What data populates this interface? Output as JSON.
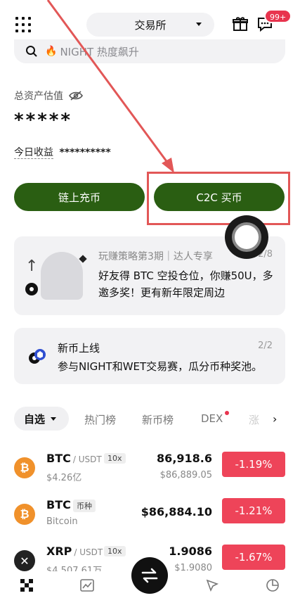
{
  "header": {
    "exchange_label": "交易所",
    "notification_count": "99+"
  },
  "search": {
    "placeholder": "NIGHT 热度飙升"
  },
  "assets": {
    "title": "总资产估值",
    "value": "*****",
    "today_label": "今日收益",
    "today_value": "**********"
  },
  "actions": {
    "deposit_label": "链上充币",
    "c2c_label": "C2C 买币"
  },
  "promo": {
    "title": "玩赚策略第3期｜达人专享",
    "page": "2/8",
    "body": "好友得 BTC 空投仓位，你赚50U，多邀多奖！更有新年限定周边"
  },
  "listing": {
    "title": "新币上线",
    "page": "2/2",
    "body": "参与NIGHT和WET交易赛，瓜分币种奖池。"
  },
  "tabs": [
    {
      "label": "自选"
    },
    {
      "label": "热门榜"
    },
    {
      "label": "新币榜"
    },
    {
      "label": "DEX"
    },
    {
      "label": "涨"
    }
  ],
  "market_rows": [
    {
      "symbol": "BTC",
      "quote": "/ USDT",
      "tag": "10x",
      "sub": "$4.26亿",
      "price": "86,918.6",
      "price_sub": "$86,889.05",
      "change": "-1.19%",
      "coin_glyph": "₿"
    },
    {
      "symbol": "BTC",
      "quote": "",
      "tag": "币种",
      "sub": "Bitcoin",
      "price": "$86,884.10",
      "price_sub": "",
      "change": "-1.21%",
      "coin_glyph": "₿"
    },
    {
      "symbol": "XRP",
      "quote": "/ USDT",
      "tag": "10x",
      "sub": "$4,507.61万",
      "price": "1.9086",
      "price_sub": "$1.9080",
      "change": "-1.67%",
      "coin_glyph": "✕"
    }
  ],
  "colors": {
    "accent_green": "#2a5e12",
    "negative_red": "#ee4459",
    "annotation_red": "#e25757"
  }
}
